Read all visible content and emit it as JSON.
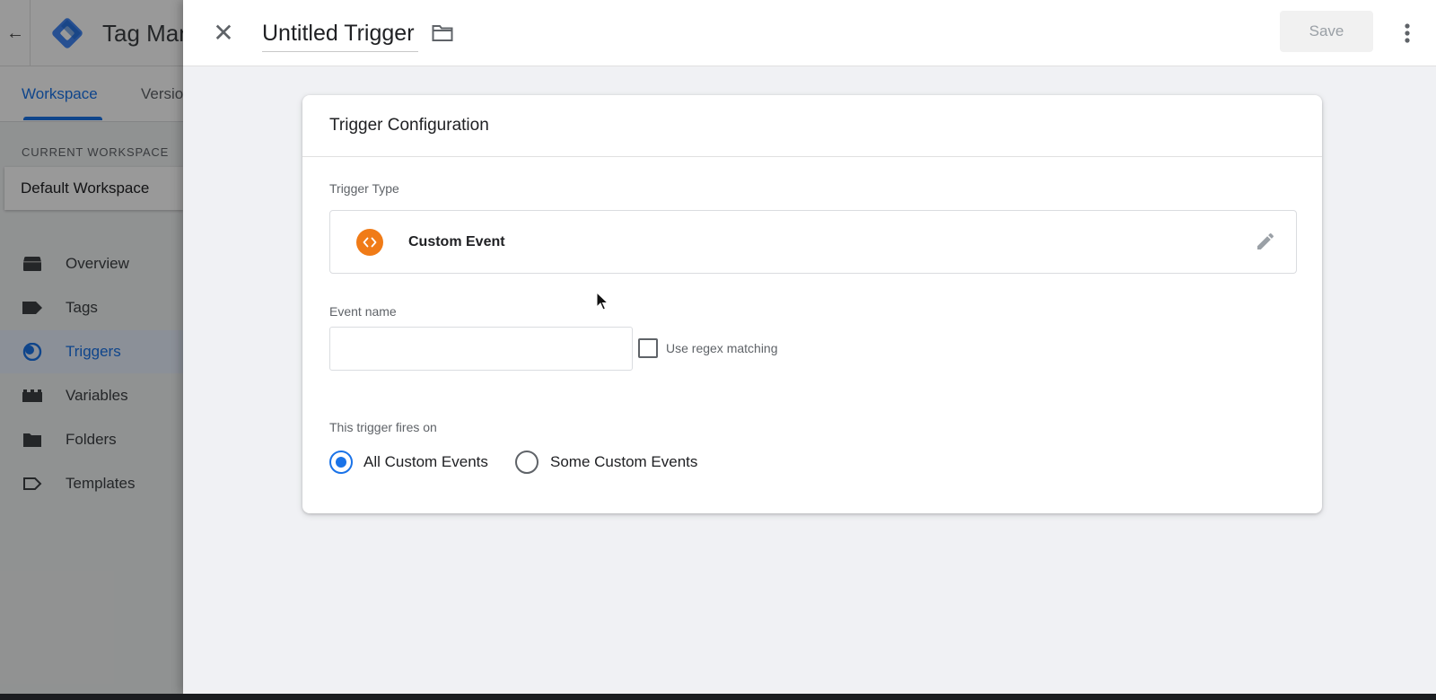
{
  "app": {
    "title": "Tag Manager"
  },
  "background": {
    "tabs": [
      {
        "label": "Workspace",
        "active": true
      },
      {
        "label": "Versions",
        "active": false
      }
    ],
    "current_workspace_label": "CURRENT WORKSPACE",
    "current_workspace_name": "Default Workspace",
    "nav": [
      {
        "label": "Overview",
        "icon": "overview-icon",
        "active": false
      },
      {
        "label": "Tags",
        "icon": "tag-icon",
        "active": false
      },
      {
        "label": "Triggers",
        "icon": "trigger-icon",
        "active": true
      },
      {
        "label": "Variables",
        "icon": "variables-icon",
        "active": false
      },
      {
        "label": "Folders",
        "icon": "folder-icon",
        "active": false
      },
      {
        "label": "Templates",
        "icon": "templates-icon",
        "active": false
      }
    ]
  },
  "editor": {
    "title": "Untitled Trigger",
    "save_label": "Save",
    "card": {
      "title": "Trigger Configuration",
      "trigger_type_label": "Trigger Type",
      "trigger_type_name": "Custom Event",
      "trigger_type_icon": "custom-event-icon",
      "event_name_label": "Event name",
      "event_name_value": "",
      "regex_label": "Use regex matching",
      "regex_checked": false,
      "fires_on_label": "This trigger fires on",
      "fires_on_options": [
        {
          "label": "All Custom Events",
          "checked": true
        },
        {
          "label": "Some Custom Events",
          "checked": false
        }
      ]
    }
  },
  "colors": {
    "accent": "#1a73e8",
    "custom_event_icon": "#f07b17",
    "logo_blue": "#4285f4",
    "logo_dark": "#1967d2"
  }
}
